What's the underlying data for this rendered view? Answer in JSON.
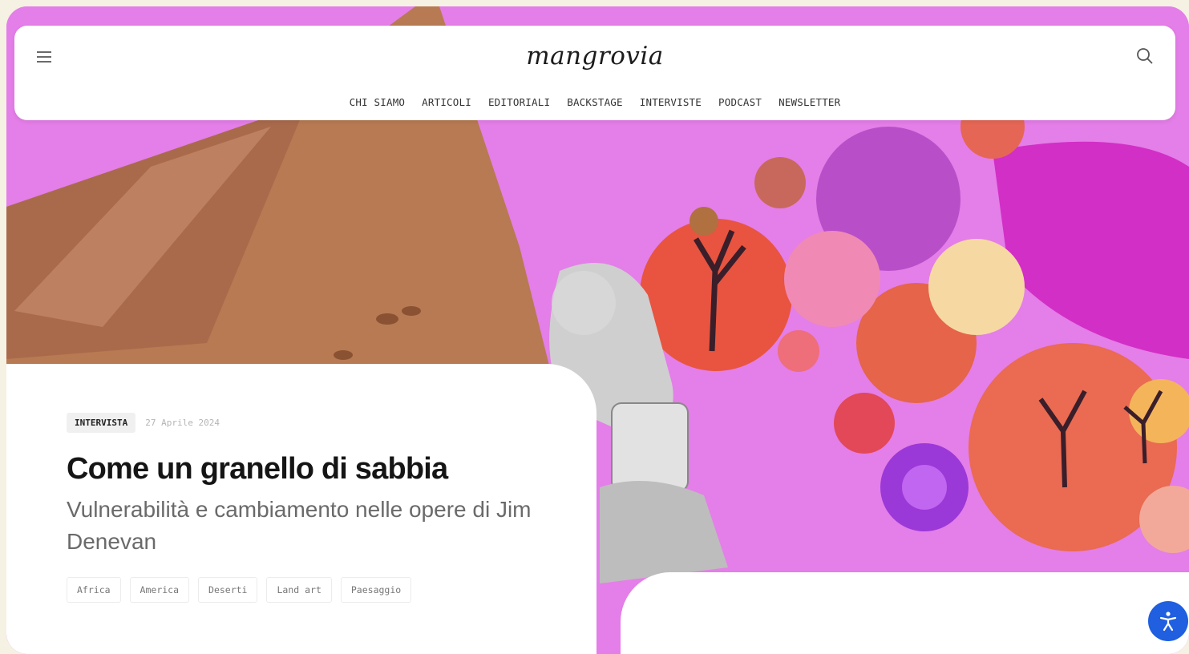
{
  "header": {
    "logo": "mangrovia",
    "nav": [
      "CHI SIAMO",
      "ARTICOLI",
      "EDITORIALI",
      "BACKSTAGE",
      "INTERVISTE",
      "PODCAST",
      "NEWSLETTER"
    ]
  },
  "article": {
    "category": "INTERVISTA",
    "date": "27 Aprile 2024",
    "title": "Come un granello di sabbia",
    "subtitle": "Vulnerabilità e cambiamento nelle opere di Jim Denevan",
    "tags": [
      "Africa",
      "America",
      "Deserti",
      "Land art",
      "Paesaggio"
    ]
  },
  "icons": {
    "menu": "hamburger-menu-icon",
    "search": "search-icon",
    "accessibility": "accessibility-icon"
  },
  "colors": {
    "hero_background": "#e47ee8",
    "accessibility_button": "#1f5fe0"
  }
}
